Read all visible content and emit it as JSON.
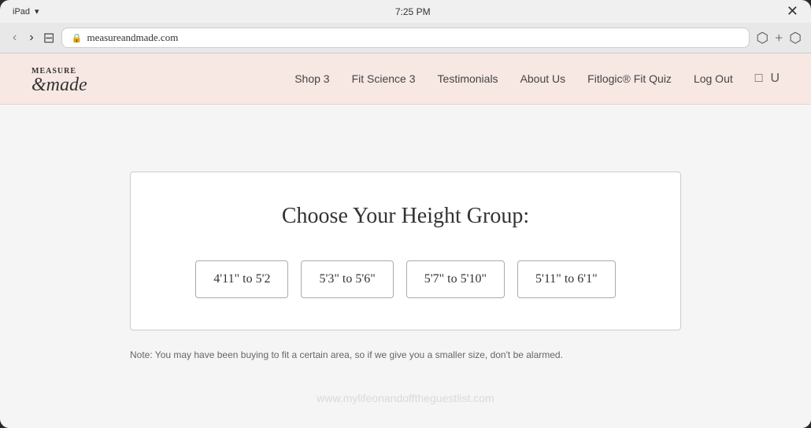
{
  "statusBar": {
    "device": "iPad",
    "time": "7:25 PM",
    "close_icon": "✕"
  },
  "browser": {
    "url": "measureandmade.com",
    "lock_label": "🔒",
    "back_label": "‹",
    "forward_label": "›",
    "bookmark_label": "□"
  },
  "nav": {
    "logo_top": "MEASURE",
    "logo_bottom": "&made",
    "items": [
      {
        "label": "Shop 3"
      },
      {
        "label": "Fit Science 3"
      },
      {
        "label": "Testimonials"
      },
      {
        "label": "About Us"
      },
      {
        "label": "Fitlogic® Fit Quiz"
      }
    ],
    "logout_label": "Log Out"
  },
  "main": {
    "card_title": "Choose Your Height Group:",
    "height_options": [
      {
        "label": "4'11\" to 5'2"
      },
      {
        "label": "5'3\" to 5'6\""
      },
      {
        "label": "5'7\" to 5'10\""
      },
      {
        "label": "5'11\" to 6'1\""
      }
    ],
    "note": "Note: You may have been buying to fit a certain area, so if we give you a smaller size, don't be alarmed."
  },
  "watermark": "www.mylifeonandofftheguestlist.com"
}
